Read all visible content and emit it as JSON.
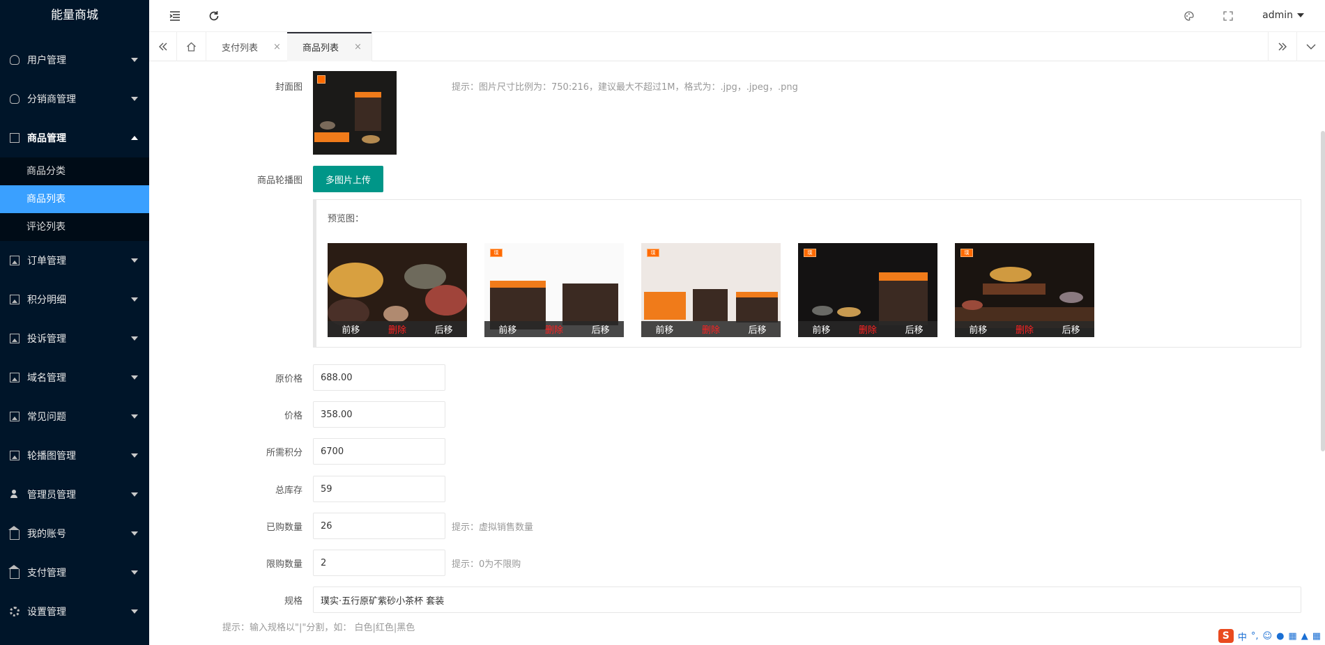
{
  "app_title": "能量商城",
  "sidebar": {
    "items": [
      {
        "label": "用户管理",
        "icon": "user-icon"
      },
      {
        "label": "分销商管理",
        "icon": "user-icon"
      },
      {
        "label": "商品管理",
        "icon": "document-icon",
        "open": true,
        "children": [
          {
            "label": "商品分类"
          },
          {
            "label": "商品列表",
            "active": true
          },
          {
            "label": "评论列表"
          }
        ]
      },
      {
        "label": "订单管理",
        "icon": "image-icon"
      },
      {
        "label": "积分明细",
        "icon": "image-icon"
      },
      {
        "label": "投诉管理",
        "icon": "image-icon"
      },
      {
        "label": "域名管理",
        "icon": "image-icon"
      },
      {
        "label": "常见问题",
        "icon": "image-icon"
      },
      {
        "label": "轮播图管理",
        "icon": "image-icon"
      },
      {
        "label": "管理员管理",
        "icon": "person-icon"
      },
      {
        "label": "我的账号",
        "icon": "home-icon"
      },
      {
        "label": "支付管理",
        "icon": "home-icon"
      },
      {
        "label": "设置管理",
        "icon": "gear-icon"
      }
    ]
  },
  "header": {
    "user": "admin"
  },
  "tabs": [
    {
      "label": "支付列表",
      "close": "×"
    },
    {
      "label": "商品列表",
      "close": "×",
      "active": true
    }
  ],
  "form": {
    "cover_label": "封面图",
    "cover_tip": "提示：图片尺寸比例为：750:216，建议最大不超过1M，格式为：.jpg，.jpeg，.png",
    "carousel_label": "商品轮播图",
    "upload_button": "多图片上传",
    "preview_title": "预览图：",
    "thumb_actions": {
      "prev": "前移",
      "delete": "删除",
      "next": "后移"
    },
    "original_price_label": "原价格",
    "original_price": "688.00",
    "price_label": "价格",
    "price": "358.00",
    "points_label": "所需积分",
    "points": "6700",
    "stock_label": "总库存",
    "stock": "59",
    "sold_label": "已购数量",
    "sold": "26",
    "sold_tip": "提示：虚拟销售数量",
    "limit_label": "限购数量",
    "limit": "2",
    "limit_tip": "提示：0为不限购",
    "spec_label": "规格",
    "spec": "璞实·五行原矿紫砂小茶杯 套装",
    "spec_tip": "提示：输入规格以\"|\"分割，如： 白色|红色|黑色"
  },
  "ime": {
    "logo": "S",
    "lang": "中"
  },
  "colors": {
    "sidebar_bg": "#001529",
    "active_item": "#3aa0ff",
    "upload_button": "#009688",
    "delete_text": "#ff2222"
  }
}
